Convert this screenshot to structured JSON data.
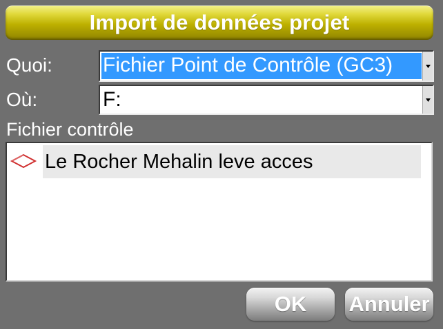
{
  "dialog": {
    "title": "Import de données projet"
  },
  "form": {
    "what_label": "Quoi:",
    "what_value": "Fichier Point de Contrôle (GC3)",
    "where_label": "Où:",
    "where_value": "F:",
    "list_label": "Fichier contrôle"
  },
  "file_list": {
    "items": [
      {
        "name": "Le Rocher Mehalin leve acces",
        "icon": "control-point-diamond-icon"
      }
    ]
  },
  "buttons": {
    "ok_label": "OK",
    "cancel_label": "Annuler"
  },
  "colors": {
    "title_bar": "#c9bf10",
    "background": "#6f6f6f",
    "selection": "#3399ff",
    "diamond_icon": "#d03030"
  }
}
